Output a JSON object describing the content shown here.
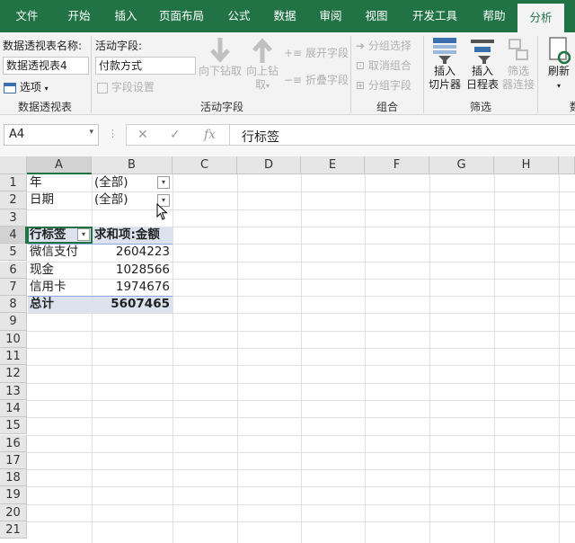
{
  "tabs": [
    "文件",
    "开始",
    "插入",
    "页面布局",
    "公式",
    "数据",
    "审阅",
    "视图",
    "开发工具",
    "帮助",
    "分析"
  ],
  "active_tab": "分析",
  "ribbon": {
    "pivot_name_label": "数据透视表名称:",
    "pivot_name_value": "数据透视表4",
    "options_label": "选项",
    "group_pivot": "数据透视表",
    "active_field_label": "活动字段:",
    "active_field_value": "付款方式",
    "field_settings": "字段设置",
    "drill_down": "向下钻取",
    "drill_up_1": "向上钻",
    "drill_up_2": "取",
    "expand_field": "展开字段",
    "collapse_field": "折叠字段",
    "group_active_field": "活动字段",
    "group_selection": "分组选择",
    "ungroup": "取消组合",
    "group_field": "分组字段",
    "group_group": "组合",
    "insert_slicer_1": "插入",
    "insert_slicer_2": "切片器",
    "insert_timeline_1": "插入",
    "insert_timeline_2": "日程表",
    "filter_conn_1": "筛选",
    "filter_conn_2": "器连接",
    "group_filter": "筛选",
    "refresh": "刷新",
    "group_data_partial": "数"
  },
  "formula_bar": {
    "name_box": "A4",
    "cancel": "✕",
    "enter": "✓",
    "fx": "fx",
    "formula": "行标签"
  },
  "columns": [
    "A",
    "B",
    "C",
    "D",
    "E",
    "F",
    "G",
    "H"
  ],
  "rows": [
    "1",
    "2",
    "3",
    "4",
    "5",
    "6",
    "7",
    "8",
    "9",
    "10",
    "11",
    "12",
    "13",
    "14",
    "15",
    "16",
    "17",
    "18",
    "19",
    "20",
    "21"
  ],
  "cells": {
    "a1": "年",
    "b1": "(全部)",
    "a2": "日期",
    "b2": "(全部)",
    "a4": "行标签",
    "b4": "求和项:金额",
    "a5": "微信支付",
    "b5": "2604223",
    "a6": "现金",
    "b6": "1028566",
    "a7": "信用卡",
    "b7": "1974676",
    "a8": "总计",
    "b8": "5607465"
  },
  "colors": {
    "excel_green": "#217346",
    "pivot_header_band": "#dce3ef"
  }
}
